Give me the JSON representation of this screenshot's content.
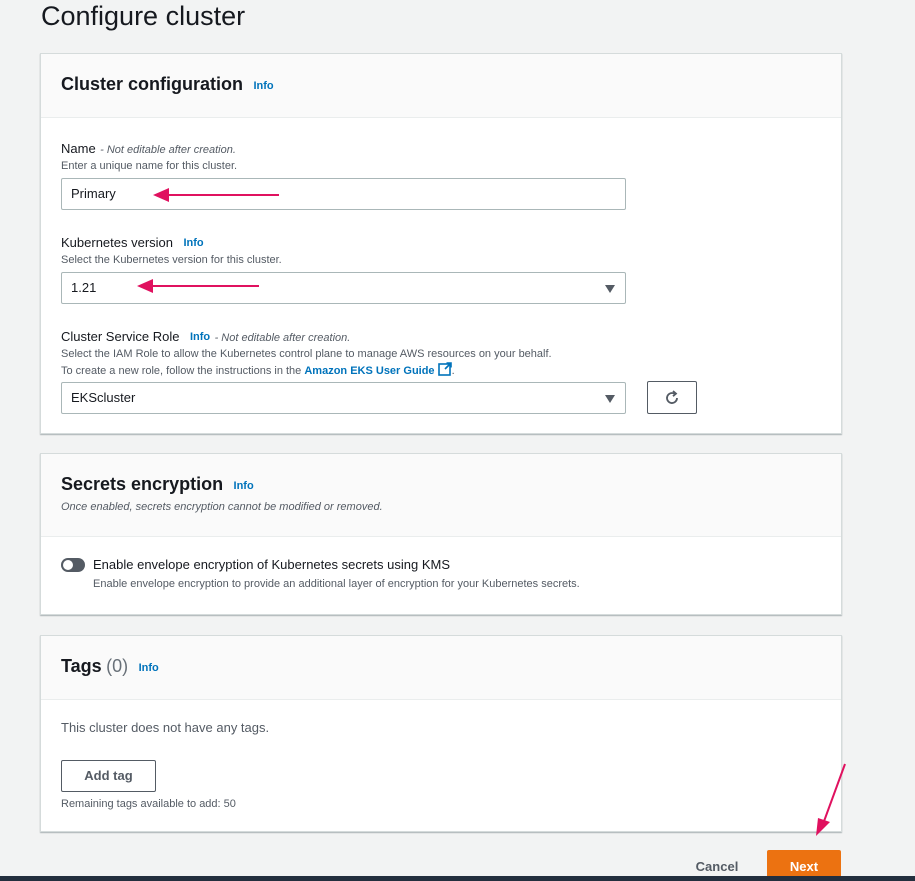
{
  "page": {
    "title": "Configure cluster"
  },
  "cluster_config": {
    "title": "Cluster configuration",
    "info": "Info",
    "name_label": "Name",
    "name_note": "- Not editable after creation.",
    "name_desc": "Enter a unique name for this cluster.",
    "name_value": "Primary",
    "k8s_label": "Kubernetes version",
    "k8s_info": "Info",
    "k8s_desc": "Select the Kubernetes version for this cluster.",
    "k8s_value": "1.21",
    "role_label": "Cluster Service Role",
    "role_info": "Info",
    "role_note": "- Not editable after creation.",
    "role_desc1": "Select the IAM Role to allow the Kubernetes control plane to manage AWS resources on your behalf.",
    "role_desc2_prefix": "To create a new role, follow the instructions in the",
    "role_desc2_link": "Amazon EKS User Guide",
    "role_desc2_suffix": ".",
    "role_value": "EKScluster"
  },
  "secrets": {
    "title": "Secrets encryption",
    "info": "Info",
    "subtitle": "Once enabled, secrets encryption cannot be modified or removed.",
    "toggle_label": "Enable envelope encryption of Kubernetes secrets using KMS",
    "toggle_desc": "Enable envelope encryption to provide an additional layer of encryption for your Kubernetes secrets.",
    "toggle_on": false
  },
  "tags": {
    "title": "Tags",
    "count": "(0)",
    "info": "Info",
    "empty_text": "This cluster does not have any tags.",
    "add_button": "Add tag",
    "remaining": "Remaining tags available to add: 50"
  },
  "footer": {
    "cancel": "Cancel",
    "next": "Next"
  },
  "colors": {
    "accent": "#ec7211",
    "link": "#0073bb",
    "annotation_arrow": "#e0115f"
  },
  "icons": {
    "refresh": "refresh-icon",
    "external_link": "external-link-icon",
    "caret": "caret-down-icon"
  }
}
